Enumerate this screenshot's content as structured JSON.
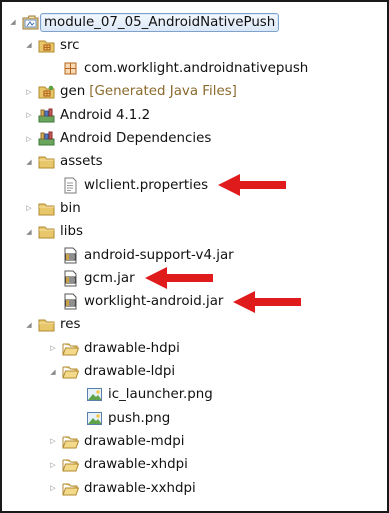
{
  "tree": {
    "items": [
      {
        "label": "module_07_05_AndroidNativePush",
        "decoration": "",
        "icon": "project-icon",
        "depth": 0,
        "expanded": true,
        "selected": true
      },
      {
        "label": "src",
        "decoration": "",
        "icon": "source-folder-icon",
        "depth": 1,
        "expanded": true,
        "selected": false
      },
      {
        "label": "com.worklight.androidnativepush",
        "decoration": "",
        "icon": "package-icon",
        "depth": 2,
        "expanded": null,
        "selected": false
      },
      {
        "label": "gen",
        "decoration": "[Generated Java Files]",
        "icon": "generated-folder-icon",
        "depth": 1,
        "expanded": false,
        "selected": false
      },
      {
        "label": "Android 4.1.2",
        "decoration": "",
        "icon": "library-icon",
        "depth": 1,
        "expanded": false,
        "selected": false
      },
      {
        "label": "Android Dependencies",
        "decoration": "",
        "icon": "library-icon",
        "depth": 1,
        "expanded": false,
        "selected": false
      },
      {
        "label": "assets",
        "decoration": "",
        "icon": "folder-icon",
        "depth": 1,
        "expanded": true,
        "selected": false
      },
      {
        "label": "wlclient.properties",
        "decoration": "",
        "icon": "file-icon",
        "depth": 2,
        "expanded": null,
        "selected": false
      },
      {
        "label": "bin",
        "decoration": "",
        "icon": "folder-icon",
        "depth": 1,
        "expanded": false,
        "selected": false
      },
      {
        "label": "libs",
        "decoration": "",
        "icon": "folder-icon",
        "depth": 1,
        "expanded": true,
        "selected": false
      },
      {
        "label": "android-support-v4.jar",
        "decoration": "",
        "icon": "jar-icon",
        "depth": 2,
        "expanded": null,
        "selected": false
      },
      {
        "label": "gcm.jar",
        "decoration": "",
        "icon": "jar-icon",
        "depth": 2,
        "expanded": null,
        "selected": false
      },
      {
        "label": "worklight-android.jar",
        "decoration": "",
        "icon": "jar-icon",
        "depth": 2,
        "expanded": null,
        "selected": false
      },
      {
        "label": "res",
        "decoration": "",
        "icon": "folder-icon",
        "depth": 1,
        "expanded": true,
        "selected": false
      },
      {
        "label": "drawable-hdpi",
        "decoration": "",
        "icon": "open-folder-icon",
        "depth": 2,
        "expanded": false,
        "selected": false
      },
      {
        "label": "drawable-ldpi",
        "decoration": "",
        "icon": "open-folder-icon",
        "depth": 2,
        "expanded": true,
        "selected": false
      },
      {
        "label": "ic_launcher.png",
        "decoration": "",
        "icon": "image-icon",
        "depth": 3,
        "expanded": null,
        "selected": false
      },
      {
        "label": "push.png",
        "decoration": "",
        "icon": "image-icon",
        "depth": 3,
        "expanded": null,
        "selected": false
      },
      {
        "label": "drawable-mdpi",
        "decoration": "",
        "icon": "open-folder-icon",
        "depth": 2,
        "expanded": false,
        "selected": false
      },
      {
        "label": "drawable-xhdpi",
        "decoration": "",
        "icon": "open-folder-icon",
        "depth": 2,
        "expanded": false,
        "selected": false
      },
      {
        "label": "drawable-xxhdpi",
        "decoration": "",
        "icon": "open-folder-icon",
        "depth": 2,
        "expanded": false,
        "selected": false
      }
    ],
    "highlighted": [
      "wlclient.properties",
      "gcm.jar",
      "worklight-android.jar"
    ]
  },
  "colors": {
    "arrow": "#e01b1b",
    "decoration": "#8a6a2d",
    "folder": "#e8c66a",
    "folder_outline": "#b08a2e",
    "library": "#3d7a3a",
    "package": "#b5651d"
  }
}
